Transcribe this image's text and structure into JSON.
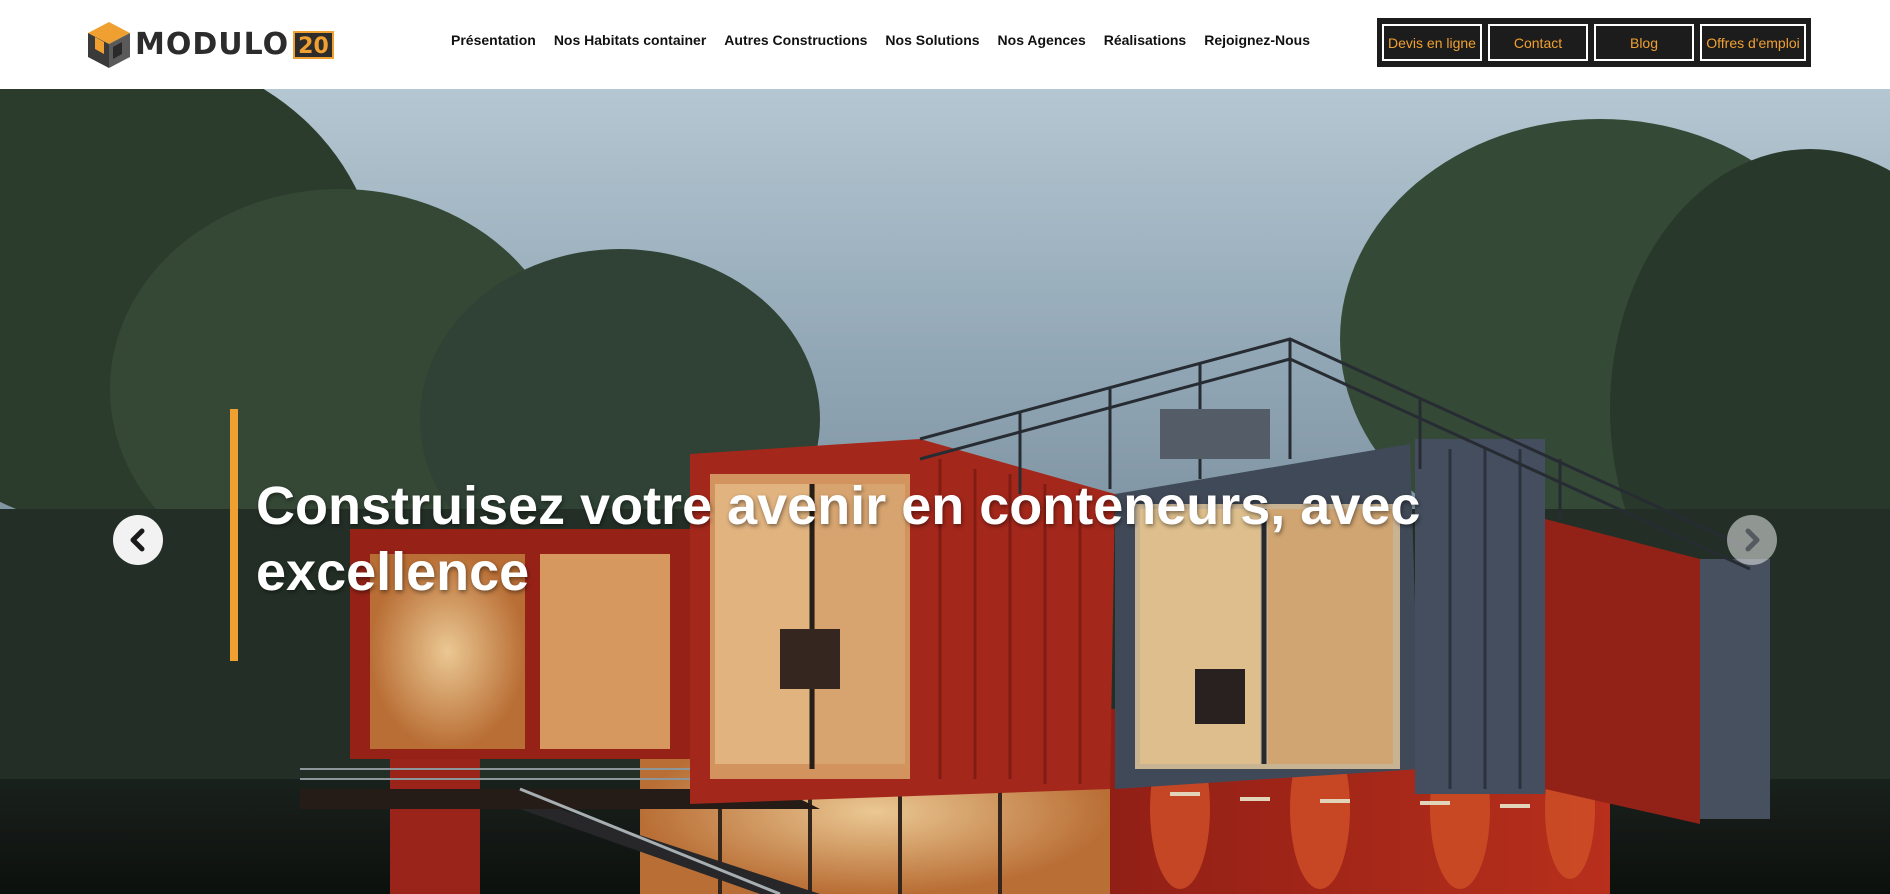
{
  "logo": {
    "text": "MODULO",
    "number": "20"
  },
  "nav": {
    "items": [
      {
        "label": "Présentation"
      },
      {
        "label": "Nos Habitats container"
      },
      {
        "label": "Autres Constructions"
      },
      {
        "label": "Nos Solutions"
      },
      {
        "label": "Nos Agences"
      },
      {
        "label": "Réalisations"
      },
      {
        "label": "Rejoignez-Nous"
      }
    ]
  },
  "cta": {
    "quote_label": "Devis en ligne",
    "contact_label": "Contact",
    "blog_label": "Blog",
    "jobs_label": "Offres d'emploi"
  },
  "hero": {
    "title": "Construisez votre avenir en conteneurs, avec excellence"
  },
  "colors": {
    "accent": "#f0a030",
    "dark": "#1c1c1c",
    "container_red": "#b3261c",
    "container_blue": "#3f4a5c"
  },
  "icons": {
    "prev": "chevron-left-icon",
    "next": "chevron-right-icon"
  }
}
